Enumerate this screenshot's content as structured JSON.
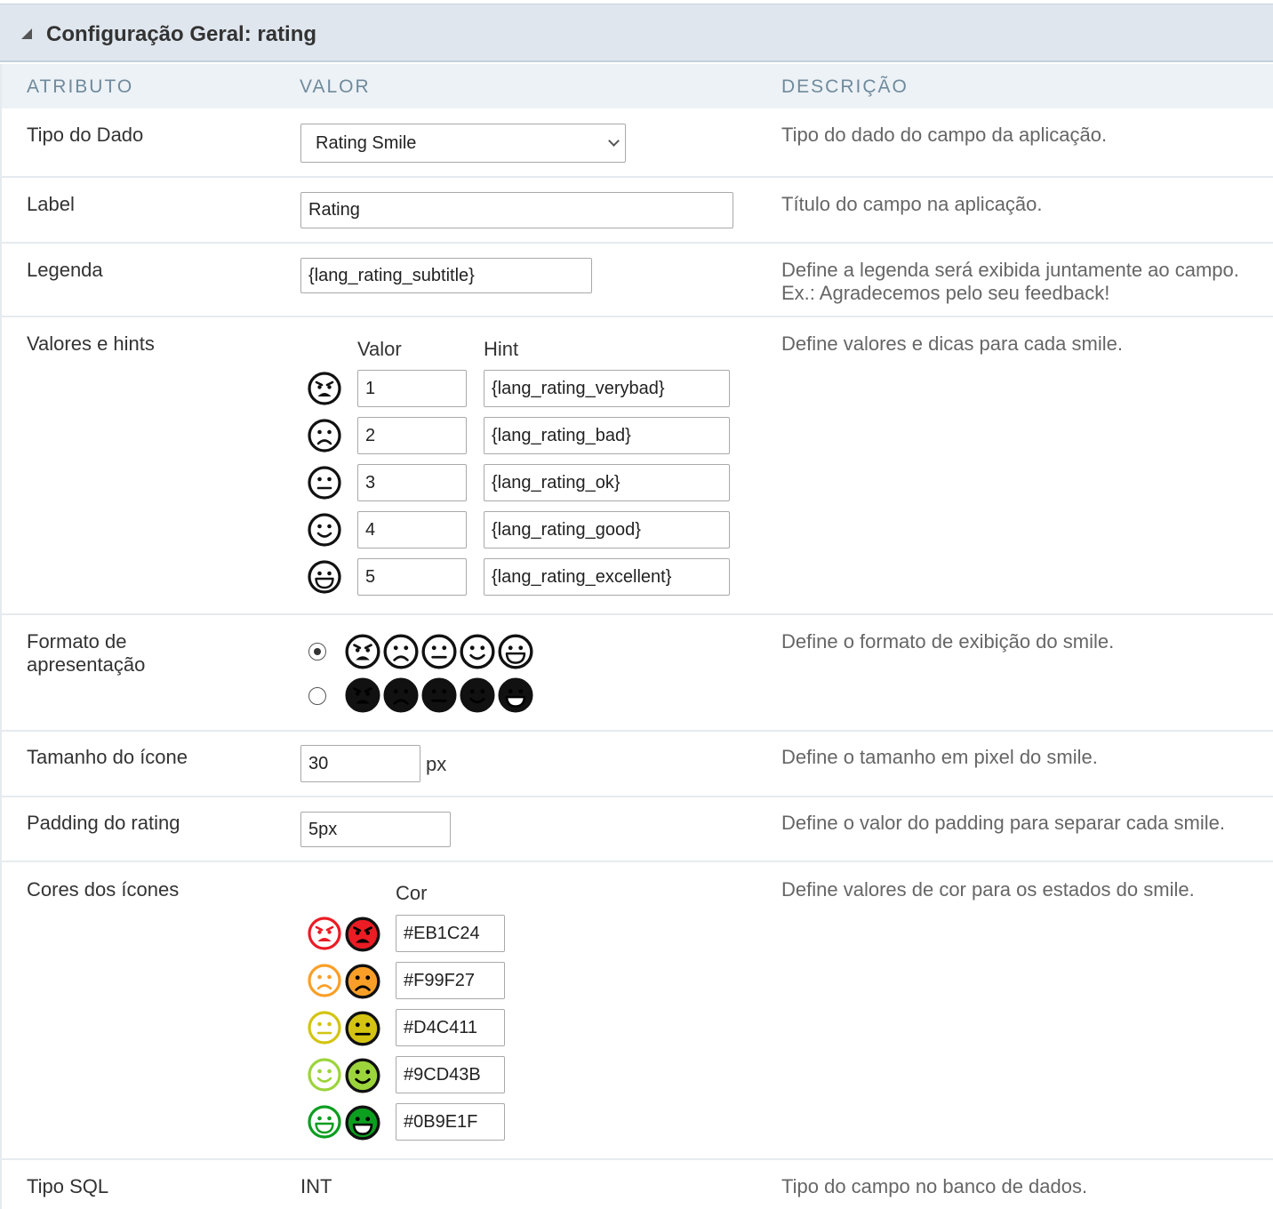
{
  "section": {
    "title": "Configuração Geral: rating"
  },
  "columns": {
    "attribute": "ATRIBUTO",
    "value": "VALOR",
    "description": "DESCRIÇÃO"
  },
  "rows": {
    "tipo_dado": {
      "label": "Tipo do Dado",
      "value": "Rating Smile",
      "desc": "Tipo do dado do campo da aplicação."
    },
    "label": {
      "label": "Label",
      "value": "Rating",
      "desc": "Título do campo na aplicação."
    },
    "legenda": {
      "label": "Legenda",
      "value": "{lang_rating_subtitle}",
      "desc1": "Define a legenda será exibida juntamente ao campo.",
      "desc2": "Ex.: Agradecemos pelo seu feedback!"
    },
    "valores": {
      "label": "Valores e hints",
      "col_valor": "Valor",
      "col_hint": "Hint",
      "desc": "Define valores e dicas para cada smile.",
      "items": [
        {
          "value": "1",
          "hint": "{lang_rating_verybad}",
          "icon": "angry-face-icon"
        },
        {
          "value": "2",
          "hint": "{lang_rating_bad}",
          "icon": "sad-face-icon"
        },
        {
          "value": "3",
          "hint": "{lang_rating_ok}",
          "icon": "neutral-face-icon"
        },
        {
          "value": "4",
          "hint": "{lang_rating_good}",
          "icon": "smile-face-icon"
        },
        {
          "value": "5",
          "hint": "{lang_rating_excellent}",
          "icon": "grin-face-icon"
        }
      ]
    },
    "formato": {
      "label1": "Formato de",
      "label2": "apresentação",
      "desc": "Define o formato de exibição do smile.",
      "options": [
        {
          "style": "outline",
          "selected": true
        },
        {
          "style": "solid",
          "selected": false
        }
      ]
    },
    "tamanho": {
      "label": "Tamanho do ícone",
      "value": "30",
      "unit": "px",
      "desc": "Define o tamanho em pixel do smile."
    },
    "padding": {
      "label": "Padding do rating",
      "value": "5px",
      "desc": "Define o valor do padding para separar cada smile."
    },
    "cores": {
      "label": "Cores dos ícones",
      "col_cor": "Cor",
      "desc": "Define valores de cor para os estados do smile.",
      "items": [
        {
          "color": "#EB1C24"
        },
        {
          "color": "#F99F27"
        },
        {
          "color": "#D4C411"
        },
        {
          "color": "#9CD43B"
        },
        {
          "color": "#0B9E1F"
        }
      ]
    },
    "sql": {
      "label": "Tipo SQL",
      "value": "INT",
      "desc": "Tipo do campo no banco de dados."
    }
  }
}
